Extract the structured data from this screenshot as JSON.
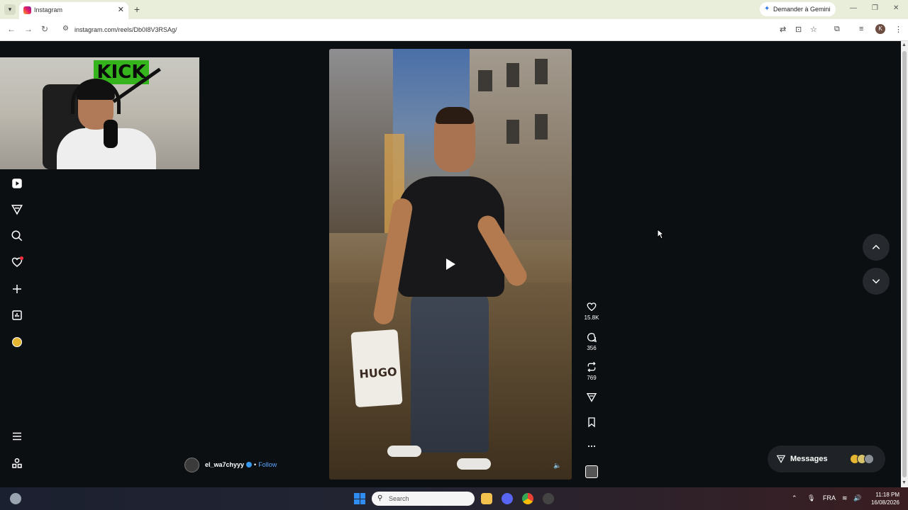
{
  "browser": {
    "tab_title": "Instagram",
    "tab_close": "✕",
    "new_tab": "+",
    "gemini_label": "Demander à Gemini",
    "url": "instagram.com/reels/Db0I8V3RSAg/",
    "profile_initial": "K",
    "window_minimize": "—",
    "window_restore": "❐",
    "window_close": "✕"
  },
  "webcam": {
    "sign_text": "KICK"
  },
  "sidebar": {
    "items": [
      {
        "icon": "reels-icon"
      },
      {
        "icon": "explore-icon"
      },
      {
        "icon": "search-icon"
      },
      {
        "icon": "notifications-heart-icon"
      },
      {
        "icon": "create-plus-icon"
      },
      {
        "icon": "dashboard-icon"
      },
      {
        "icon": "profile-avatar-icon"
      },
      {
        "icon": "menu-icon"
      },
      {
        "icon": "also-from-meta-icon"
      }
    ]
  },
  "reel": {
    "bag_text": "HUGO",
    "actions": {
      "likes": "15.8K",
      "comments": "356",
      "reposts": "769"
    },
    "author": {
      "username": "el_wa7chyyy",
      "separator": "•",
      "follow_label": "Follow"
    }
  },
  "messages": {
    "label": "Messages"
  },
  "taskbar": {
    "search_placeholder": "Search",
    "language": "FRA",
    "time": "11:18 PM",
    "date": "16/08/2026"
  },
  "colors": {
    "accent_link": "#5aa7ff",
    "notification": "#ff3040",
    "verified": "#3897f0",
    "page_bg": "#0c0f12"
  }
}
